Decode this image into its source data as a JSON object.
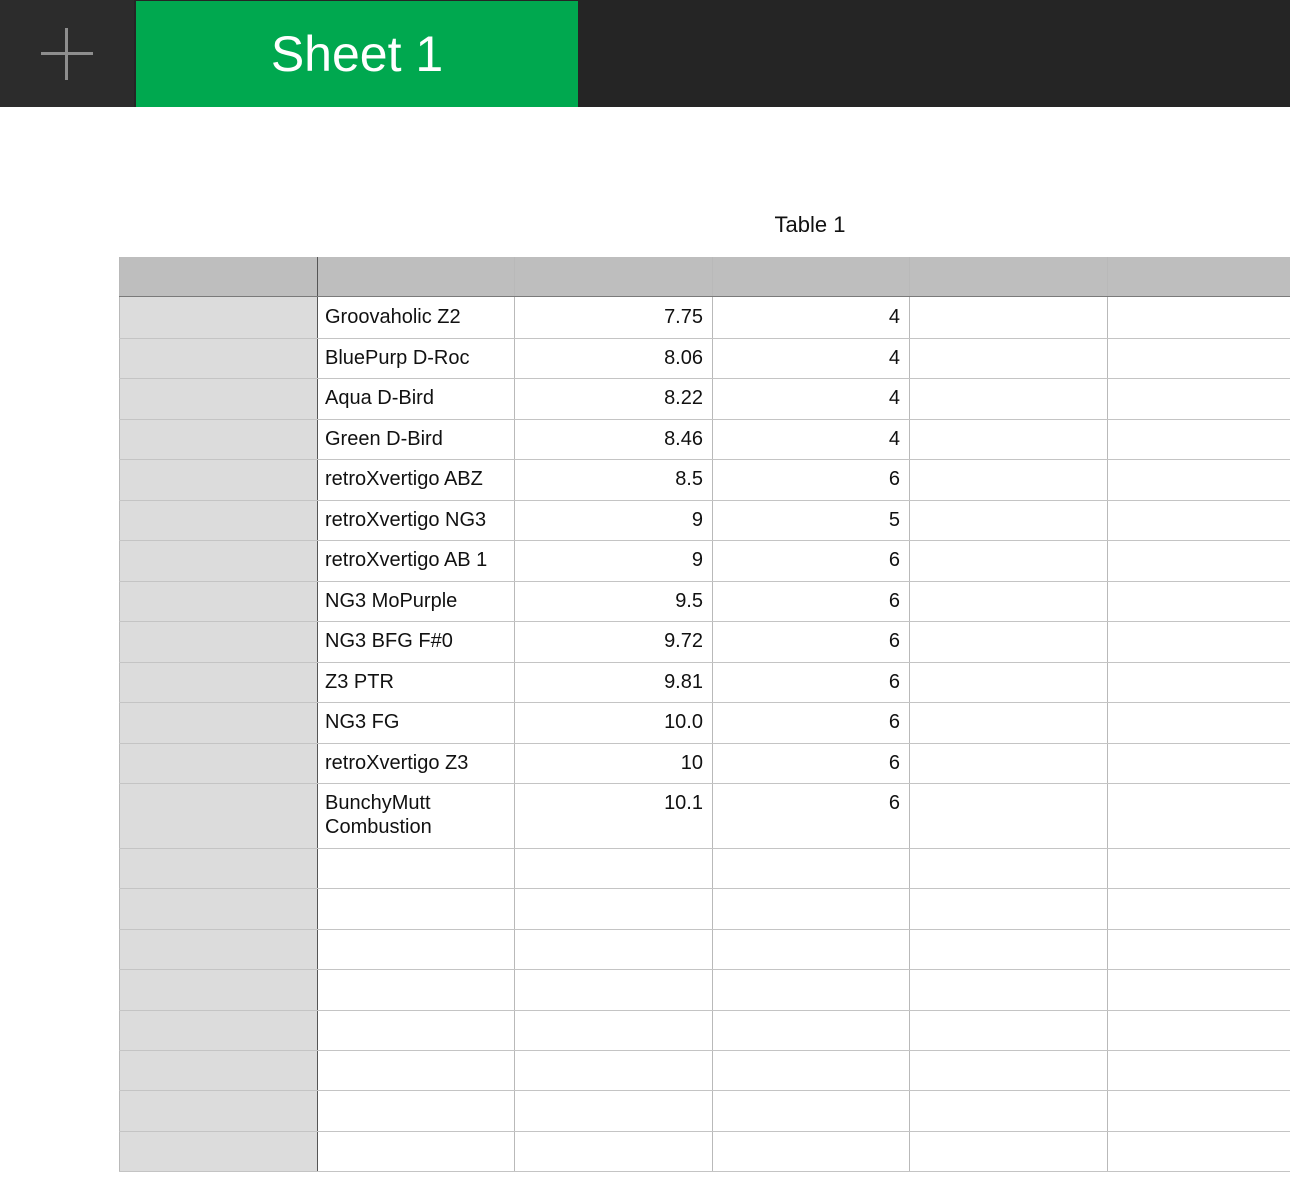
{
  "toolbar": {
    "add_icon": "plus-icon",
    "sheet_tab_label": "Sheet 1",
    "accent_color": "#00a84f"
  },
  "table": {
    "title": "Table 1",
    "rows": [
      {
        "name": "Groovaholic Z2",
        "value": "7.75",
        "count": "4"
      },
      {
        "name": "BluePurp D-Roc",
        "value": "8.06",
        "count": "4"
      },
      {
        "name": "Aqua D-Bird",
        "value": "8.22",
        "count": "4"
      },
      {
        "name": "Green D-Bird",
        "value": "8.46",
        "count": "4"
      },
      {
        "name": "retroXvertigo ABZ",
        "value": "8.5",
        "count": "6"
      },
      {
        "name": "retroXvertigo NG3",
        "value": "9",
        "count": "5"
      },
      {
        "name": "retroXvertigo AB 1",
        "value": "9",
        "count": "6"
      },
      {
        "name": "NG3 MoPurple",
        "value": "9.5",
        "count": "6"
      },
      {
        "name": "NG3 BFG F#0",
        "value": "9.72",
        "count": "6"
      },
      {
        "name": "Z3 PTR",
        "value": "9.81",
        "count": "6"
      },
      {
        "name": "NG3 FG",
        "value": "10.0",
        "count": "6"
      },
      {
        "name": "retroXvertigo Z3",
        "value": "10",
        "count": "6"
      },
      {
        "name": "BunchyMutt Combustion",
        "value": "10.1",
        "count": "6"
      }
    ],
    "empty_row_count": 8
  }
}
